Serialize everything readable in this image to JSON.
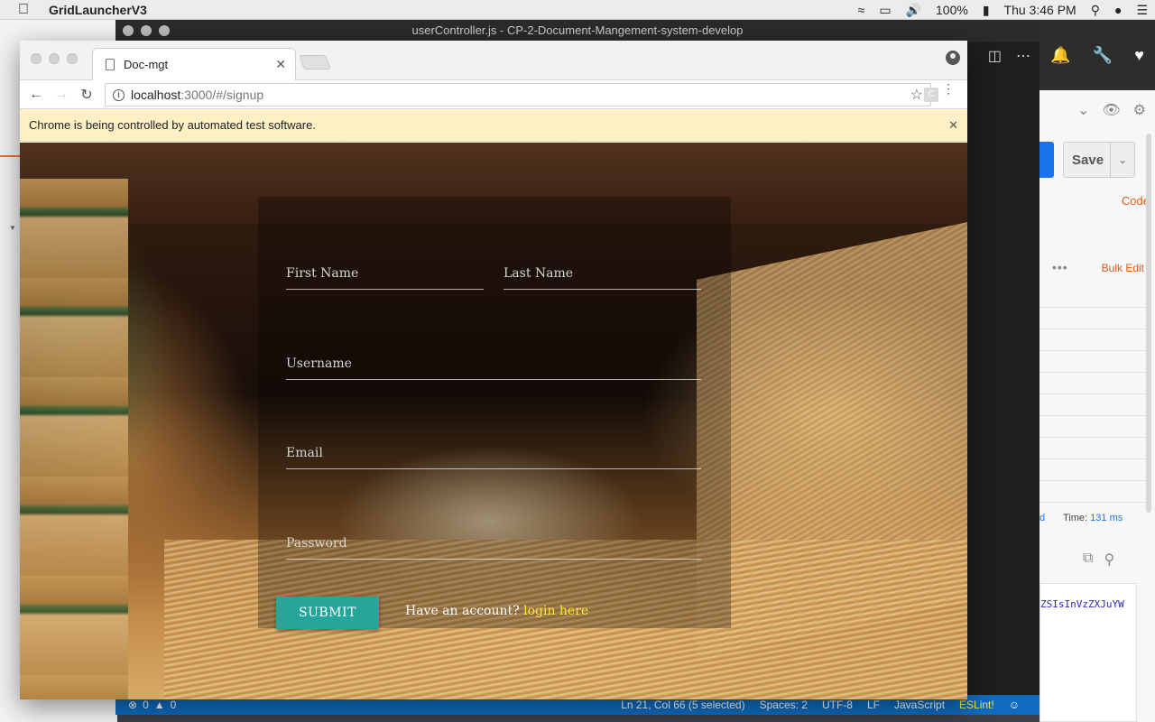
{
  "menubar": {
    "app_name": "GridLauncherV3",
    "battery": "100%",
    "clock": "Thu 3:46 PM"
  },
  "vscode": {
    "title": "userController.js - CP-2-Document-Mangement-system-develop",
    "status": {
      "errors": "0",
      "warnings": "0",
      "position": "Ln 21, Col 66 (5 selected)",
      "spaces": "Spaces: 2",
      "encoding": "UTF-8",
      "eol": "LF",
      "language": "JavaScript",
      "linter": "ESLint!"
    }
  },
  "postman": {
    "save_label": "Save",
    "code_link": "Code",
    "bulk_edit": "Bulk Edit",
    "time_label": "Time:",
    "time_value": "131 ms",
    "d_fragment": "d",
    "token_fragment": "ZSIsInVzZXJuYW"
  },
  "chrome": {
    "tab_title": "Doc-mgt",
    "url_host": "localhost",
    "url_path": ":3000/#/signup",
    "ext_letter": "C",
    "infobar_text": "Chrome is being controlled by automated test software."
  },
  "signup": {
    "first_name": "First Name",
    "last_name": "Last Name",
    "username": "Username",
    "email": "Email",
    "password": "Password",
    "submit": "SUBMIT",
    "have_account": "Have an account?",
    "login_link": "login here"
  }
}
